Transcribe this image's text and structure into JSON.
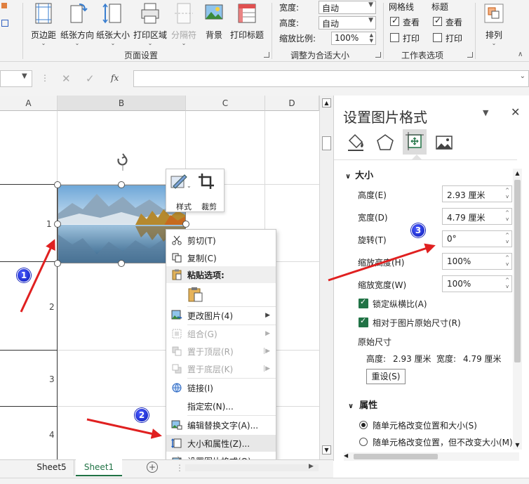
{
  "ribbon": {
    "buttons": [
      "页边距",
      "纸张方向",
      "纸张大小",
      "打印区域",
      "分隔符",
      "背景",
      "打印标题"
    ],
    "group_page_setup": "页面设置",
    "scale": {
      "width_label": "宽度:",
      "width_value": "自动",
      "height_label": "高度:",
      "height_value": "自动",
      "ratio_label": "缩放比例:",
      "ratio_value": "100%",
      "group": "调整为合适大小"
    },
    "sheet_options": {
      "gridlines": "网格线",
      "headings": "标题",
      "view": "查看",
      "print": "打印",
      "group": "工作表选项"
    },
    "arrange": "排列"
  },
  "formula_bar": {
    "fx": "fx"
  },
  "columns": [
    "A",
    "B",
    "C",
    "D"
  ],
  "rows": [
    "1",
    "2",
    "3",
    "4"
  ],
  "mini_toolbar": {
    "style": "样式",
    "crop": "裁剪"
  },
  "context_menu": {
    "cut": "剪切(T)",
    "copy": "复制(C)",
    "paste_options": "粘贴选项:",
    "change_picture": "更改图片(4)",
    "group": "组合(G)",
    "bring_front": "置于顶层(R)",
    "send_back": "置于底层(K)",
    "link": "链接(I)",
    "assign_macro": "指定宏(N)...",
    "alt_text": "编辑替换文字(A)...",
    "size_props": "大小和属性(Z)...",
    "format_picture": "设置图片格式(O)..."
  },
  "pane": {
    "title": "设置图片格式",
    "section_size": "大小",
    "height_label": "高度(E)",
    "height_value": "2.93 厘米",
    "width_label": "宽度(D)",
    "width_value": "4.79 厘米",
    "rotation_label": "旋转(T)",
    "rotation_value": "0°",
    "scale_h_label": "缩放高度(H)",
    "scale_h_value": "100%",
    "scale_w_label": "缩放宽度(W)",
    "scale_w_value": "100%",
    "lock_ratio": "锁定纵横比(A)",
    "relative_original": "相对于图片原始尺寸(R)",
    "original_size": "原始尺寸",
    "orig_height_label": "高度:",
    "orig_height": "2.93 厘米",
    "orig_width_label": "宽度:",
    "orig_width": "4.79 厘米",
    "reset": "重设(S)",
    "section_props": "属性",
    "prop_1": "随单元格改变位置和大小(S)",
    "prop_2": "随单元格改变位置，但不改变大小(M)"
  },
  "sheet_tabs": [
    "Sheet5",
    "Sheet1"
  ],
  "badges": [
    "1",
    "2",
    "3"
  ],
  "colors": {
    "accent_green": "#217346",
    "arrow_red": "#e02020",
    "badge_blue": "#1a2be0"
  }
}
